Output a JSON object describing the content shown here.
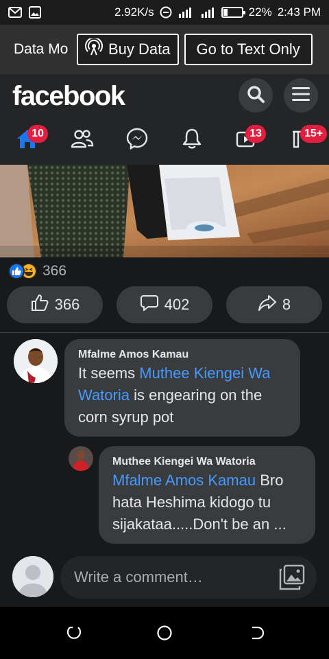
{
  "status_bar": {
    "speed": "2.92K/s",
    "battery_percent": "22%",
    "battery_level": 0.22,
    "time": "2:43 PM",
    "left_icons": [
      "gmail-icon",
      "gallery-icon"
    ],
    "right_icons": [
      "dnd-icon",
      "signal-icon",
      "signal-icon",
      "battery-icon"
    ]
  },
  "data_banner": {
    "mode_label": "Data Mo",
    "buy_label": "Buy Data",
    "text_only_label": "Go to Text Only"
  },
  "header": {
    "logo": "facebook",
    "icons": [
      "search-icon",
      "menu-icon"
    ]
  },
  "nav": {
    "items": [
      {
        "name": "home",
        "icon": "home-icon",
        "badge": "10",
        "active": true
      },
      {
        "name": "friends",
        "icon": "friends-icon",
        "badge": ""
      },
      {
        "name": "messenger",
        "icon": "messenger-icon",
        "badge": ""
      },
      {
        "name": "notifications",
        "icon": "bell-icon",
        "badge": ""
      },
      {
        "name": "watch",
        "icon": "video-icon",
        "badge": "13"
      },
      {
        "name": "marketplace",
        "icon": "store-icon",
        "badge": "15+"
      }
    ]
  },
  "colors": {
    "accent": "#1877f2",
    "badge": "#e41e3f",
    "mention": "#4599ff",
    "surface": "#242526",
    "bubble": "#3a3b3c"
  },
  "post": {
    "reaction_count": "366",
    "reactions": [
      "like-icon",
      "haha-icon"
    ],
    "actions": {
      "like_count": "366",
      "comment_count": "402",
      "share_count": "8"
    }
  },
  "comments": [
    {
      "author": "Mfalme Amos Kamau",
      "mention": "Muthee Kiengei Wa Watoria",
      "text_before": "It seems ",
      "text_after": "  is engearing on the corn syrup pot"
    },
    {
      "author": "Muthee Kiengei Wa Watoria",
      "mention": "Mfalme Amos Kamau",
      "text_before": "",
      "text_after": " Bro hata Heshima kidogo tu sijakataa.....Don't be an ..."
    }
  ],
  "composer": {
    "placeholder": "Write a comment…"
  }
}
